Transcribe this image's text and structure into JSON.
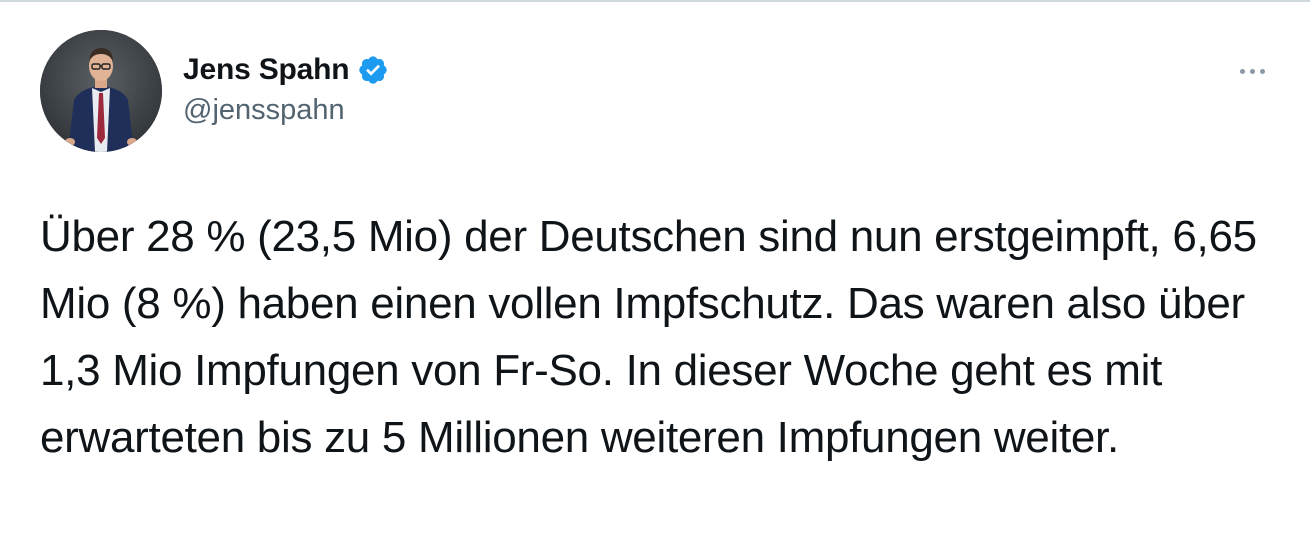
{
  "tweet": {
    "author": {
      "display_name": "Jens Spahn",
      "handle": "@jensspahn",
      "verified": true,
      "verified_color": "#1d9bf0"
    },
    "more_icon": "more-horizontal-icon",
    "text": "Über 28 % (23,5 Mio) der Deutschen sind nun erstgeimpft, 6,65 Mio (8 %) haben einen vollen Impfschutz. Das waren also über 1,3 Mio Impfungen von Fr-So. In dieser Woche geht es mit erwarteten bis zu 5 Millionen weiteren Impfungen weiter."
  }
}
